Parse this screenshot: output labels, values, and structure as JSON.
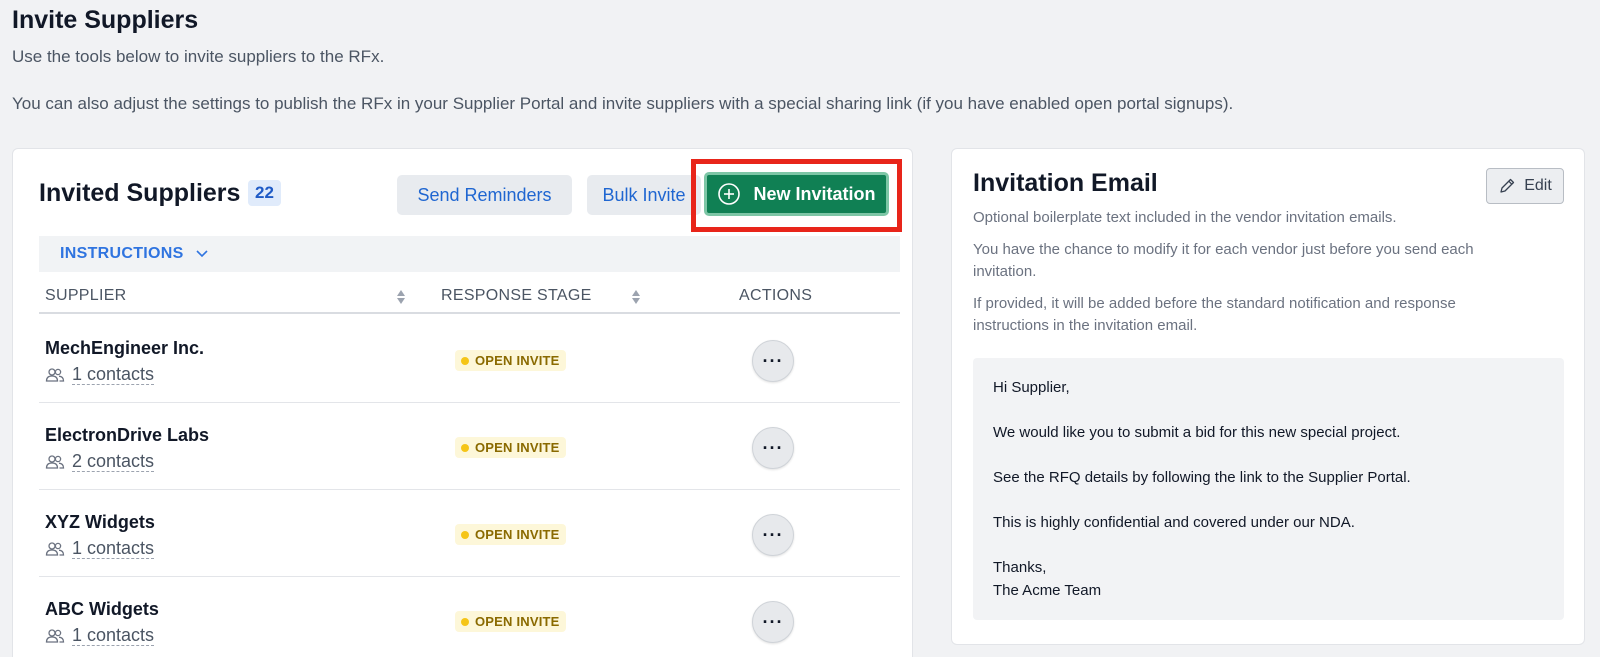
{
  "page": {
    "title": "Invite Suppliers",
    "subtitle": "Use the tools below to invite suppliers to the RFx.",
    "subtitle2": "You can also adjust the settings to publish the RFx in your Supplier Portal and invite suppliers with a special sharing link (if you have enabled open portal signups)."
  },
  "invited": {
    "title": "Invited Suppliers",
    "count": "22",
    "send_reminders_label": "Send Reminders",
    "bulk_invite_label": "Bulk Invite",
    "new_invitation_label": "New Invitation",
    "instructions_label": "INSTRUCTIONS",
    "columns": [
      "SUPPLIER",
      "RESPONSE STAGE",
      "ACTIONS"
    ],
    "rows": [
      {
        "name": "MechEngineer Inc.",
        "contacts": "1 contacts",
        "stage": "OPEN INVITE",
        "actions": "···"
      },
      {
        "name": "ElectronDrive Labs",
        "contacts": "2 contacts",
        "stage": "OPEN INVITE",
        "actions": "···"
      },
      {
        "name": "XYZ Widgets",
        "contacts": "1 contacts",
        "stage": "OPEN INVITE",
        "actions": "···"
      },
      {
        "name": "ABC Widgets",
        "contacts": "1 contacts",
        "stage": "OPEN INVITE",
        "actions": "···"
      }
    ]
  },
  "email": {
    "title": "Invitation Email",
    "edit_label": "Edit",
    "desc1": "Optional boilerplate text included in the vendor invitation emails.",
    "desc2": "You have the chance to modify it for each vendor just before you send each invitation.",
    "desc3": "If provided, it will be added before the standard notification and response instructions in the invitation email.",
    "body": {
      "greeting": "Hi Supplier,",
      "line1": "We would like you to submit a bid for this new special project.",
      "line2": "See the RFQ details by following the link to the Supplier Portal.",
      "line3": "This is highly confidential and covered under our NDA.",
      "closing": "Thanks,",
      "signature": "The Acme Team"
    }
  },
  "colors": {
    "primary_green": "#108054",
    "link_blue": "#1f66d1",
    "highlight_red": "#e8251a",
    "badge_yellow": "#f5c518"
  },
  "icons": {
    "new_invitation": "plus-circle-icon",
    "instructions": "chevron-down-icon",
    "sort": "sort-icon",
    "contacts": "users-icon",
    "edit": "pencil-icon"
  }
}
